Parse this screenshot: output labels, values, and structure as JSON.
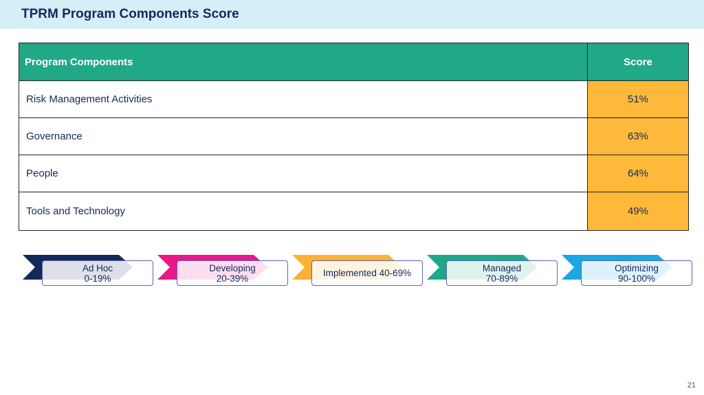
{
  "header": {
    "title": "TPRM Program Components Score"
  },
  "table": {
    "columns": [
      "Program Components",
      "Score"
    ],
    "rows": [
      {
        "component": "Risk Management Activities",
        "score": "51%"
      },
      {
        "component": "Governance",
        "score": "63%"
      },
      {
        "component": "People",
        "score": "64%"
      },
      {
        "component": "Tools and Technology",
        "score": "49%"
      }
    ],
    "header_color": "#21a886",
    "score_color": "#ffb93a"
  },
  "legend": {
    "stages": [
      {
        "name": "Ad Hoc",
        "range": "0-19%",
        "color": "#14285a"
      },
      {
        "name": "Developing",
        "range": "20-39%",
        "color": "#e8178a"
      },
      {
        "name": "Implemented 40-69%",
        "range": "",
        "color": "#f9b233"
      },
      {
        "name": "Managed",
        "range": "70-89%",
        "color": "#1ea88a"
      },
      {
        "name": "Optimizing",
        "range": "90-100%",
        "color": "#1ba6e4"
      }
    ]
  },
  "footer": {
    "page_number": "21"
  }
}
